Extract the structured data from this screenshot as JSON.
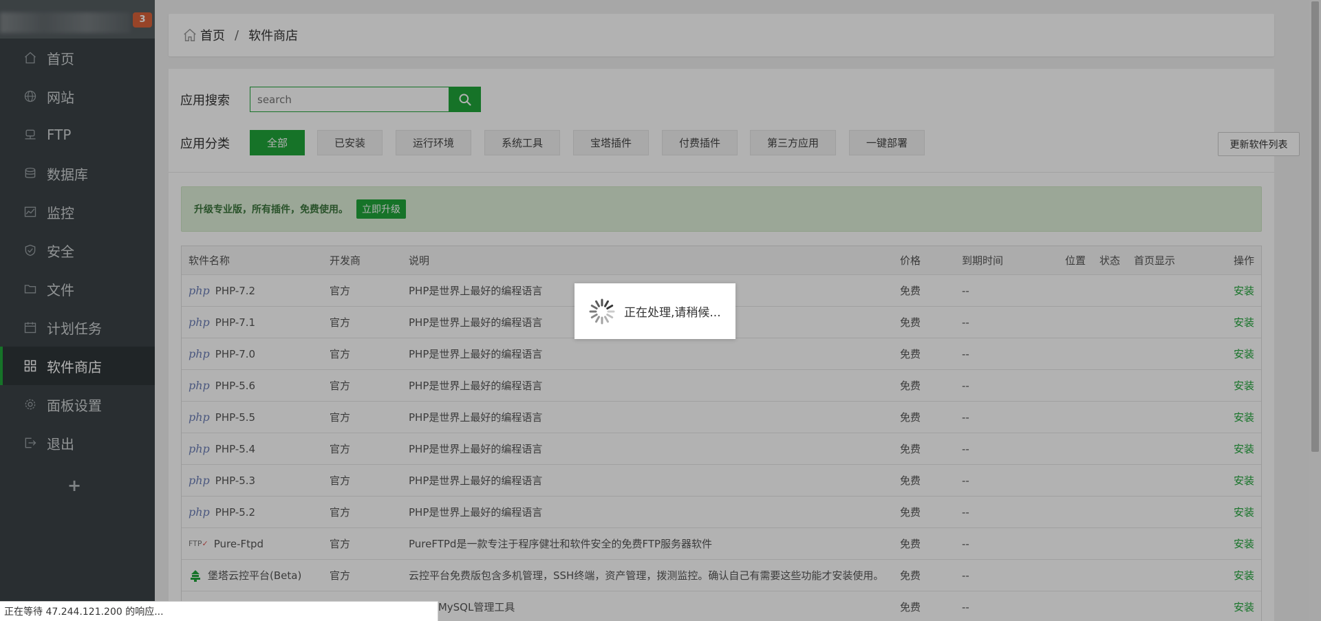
{
  "sidebar": {
    "badge": "3",
    "items": [
      {
        "label": "首页",
        "icon": "home-icon"
      },
      {
        "label": "网站",
        "icon": "globe-icon"
      },
      {
        "label": "FTP",
        "icon": "ftp-icon"
      },
      {
        "label": "数据库",
        "icon": "database-icon"
      },
      {
        "label": "监控",
        "icon": "monitor-icon"
      },
      {
        "label": "安全",
        "icon": "shield-icon"
      },
      {
        "label": "文件",
        "icon": "folder-icon"
      },
      {
        "label": "计划任务",
        "icon": "calendar-icon"
      },
      {
        "label": "软件商店",
        "icon": "grid-icon"
      },
      {
        "label": "面板设置",
        "icon": "gear-icon"
      },
      {
        "label": "退出",
        "icon": "logout-icon"
      }
    ],
    "add": "+"
  },
  "breadcrumb": {
    "home": "首页",
    "sep": "/",
    "current": "软件商店"
  },
  "search": {
    "label": "应用搜索",
    "placeholder": "search"
  },
  "category": {
    "label": "应用分类",
    "buttons": [
      "全部",
      "已安装",
      "运行环境",
      "系统工具",
      "宝塔插件",
      "付费插件",
      "第三方应用",
      "一键部署"
    ],
    "update": "更新软件列表"
  },
  "promo": {
    "text": "升级专业版，所有插件，免费使用。",
    "button": "立即升级"
  },
  "table": {
    "headers": [
      "软件名称",
      "开发商",
      "说明",
      "价格",
      "到期时间",
      "位置",
      "状态",
      "首页显示",
      "操作"
    ],
    "rows": [
      {
        "logo": "php",
        "name": "PHP-7.2",
        "dev": "官方",
        "desc": "PHP是世界上最好的编程语言",
        "price": "免费",
        "exp": "--",
        "op": "安装"
      },
      {
        "logo": "php",
        "name": "PHP-7.1",
        "dev": "官方",
        "desc": "PHP是世界上最好的编程语言",
        "price": "免费",
        "exp": "--",
        "op": "安装"
      },
      {
        "logo": "php",
        "name": "PHP-7.0",
        "dev": "官方",
        "desc": "PHP是世界上最好的编程语言",
        "price": "免费",
        "exp": "--",
        "op": "安装"
      },
      {
        "logo": "php",
        "name": "PHP-5.6",
        "dev": "官方",
        "desc": "PHP是世界上最好的编程语言",
        "price": "免费",
        "exp": "--",
        "op": "安装"
      },
      {
        "logo": "php",
        "name": "PHP-5.5",
        "dev": "官方",
        "desc": "PHP是世界上最好的编程语言",
        "price": "免费",
        "exp": "--",
        "op": "安装"
      },
      {
        "logo": "php",
        "name": "PHP-5.4",
        "dev": "官方",
        "desc": "PHP是世界上最好的编程语言",
        "price": "免费",
        "exp": "--",
        "op": "安装"
      },
      {
        "logo": "php",
        "name": "PHP-5.3",
        "dev": "官方",
        "desc": "PHP是世界上最好的编程语言",
        "price": "免费",
        "exp": "--",
        "op": "安装"
      },
      {
        "logo": "php",
        "name": "PHP-5.2",
        "dev": "官方",
        "desc": "PHP是世界上最好的编程语言",
        "price": "免费",
        "exp": "--",
        "op": "安装"
      },
      {
        "logo": "ftp",
        "name": "Pure-Ftpd",
        "dev": "官方",
        "desc": "PureFTPd是一款专注于程序健壮和软件安全的免费FTP服务器软件",
        "price": "免费",
        "exp": "--",
        "op": "安装"
      },
      {
        "logo": "bt",
        "name": "堡塔云控平台(Beta)",
        "dev": "官方",
        "desc": "云控平台免费版包含多机管理，SSH终端，资产管理，拨测监控。确认自己有需要这些功能才安装使用。",
        "price": "免费",
        "exp": "--",
        "op": "安装"
      },
      {
        "logo": "",
        "name": "",
        "dev": "",
        "desc": "Veb端MySQL管理工具",
        "price": "免费",
        "exp": "--",
        "op": "安装"
      }
    ]
  },
  "loading": {
    "text": "正在处理,请稍候..."
  },
  "statusbar": {
    "text": "正在等待 47.244.121.200 的响应..."
  },
  "colors": {
    "accent": "#20a53a",
    "sidebar": "#3b4347"
  }
}
